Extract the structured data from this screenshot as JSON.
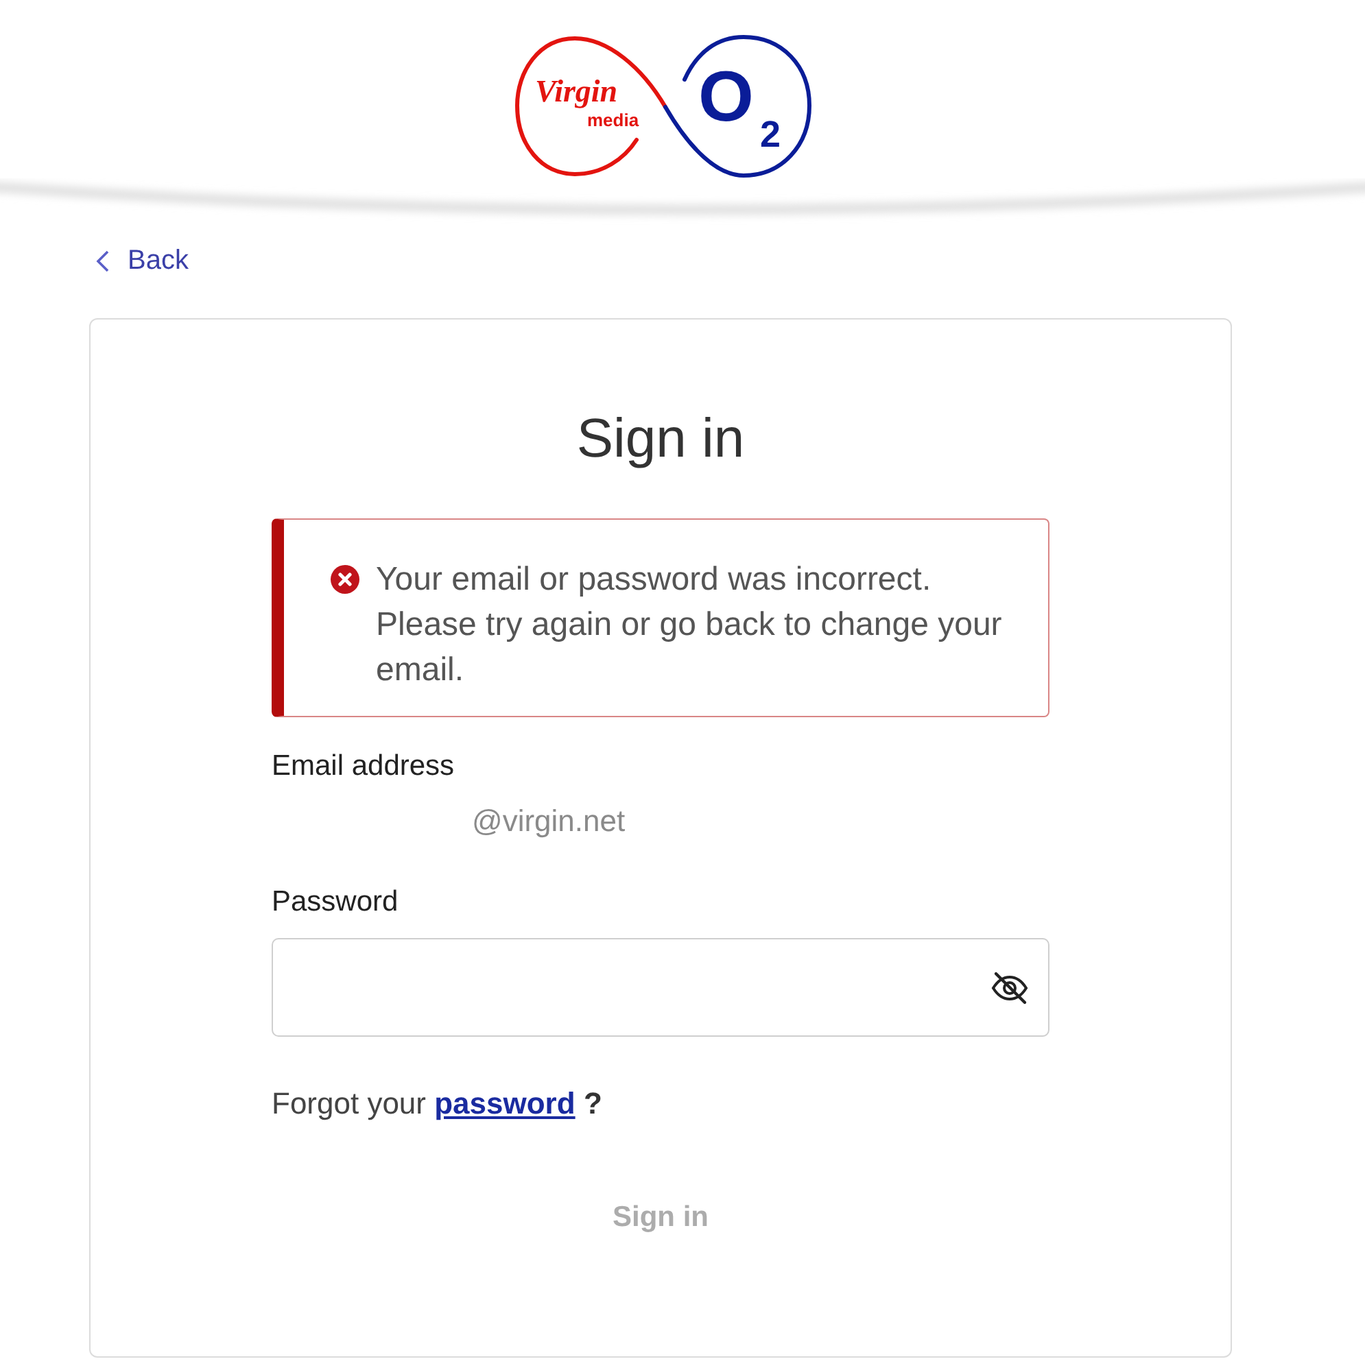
{
  "logo": {
    "left_script": "Virgin",
    "left_word": "media",
    "right_main": "O",
    "right_sub": "2"
  },
  "back_link": {
    "label": "Back"
  },
  "card": {
    "title": "Sign in",
    "alert": {
      "kind": "error",
      "message": "Your email or password was incorrect. Please try again or go back to change your email."
    },
    "email": {
      "label": "Email address",
      "value": "@virgin.net"
    },
    "password": {
      "label": "Password"
    },
    "forgot": {
      "prefix": "Forgot your",
      "link": "password",
      "suffix": "?"
    },
    "submit": {
      "label": "Sign in",
      "disabled": true
    }
  }
}
